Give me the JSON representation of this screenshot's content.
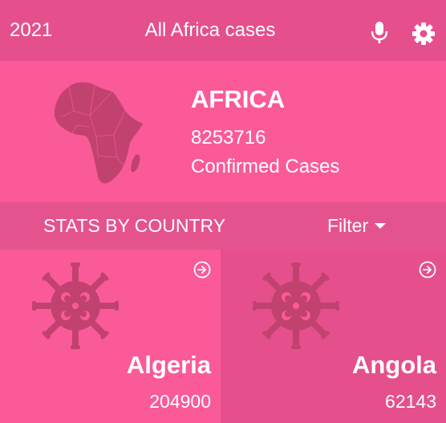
{
  "header": {
    "year": "2021",
    "title": "All Africa cases",
    "icons": [
      "microphone-icon",
      "gear-icon"
    ]
  },
  "summary": {
    "region": "AFRICA",
    "total": "8253716",
    "caption": "Confirmed Cases",
    "icon": "africa-map-icon"
  },
  "stats": {
    "title": "STATS BY COUNTRY",
    "filter_label": "Filter"
  },
  "countries": [
    {
      "name": "Algeria",
      "cases": "204900"
    },
    {
      "name": "Angola",
      "cases": "62143"
    }
  ],
  "colors": {
    "header_bg": "#e5508c",
    "primary": "#fa5a98",
    "accent_dark": "#c2426f"
  }
}
